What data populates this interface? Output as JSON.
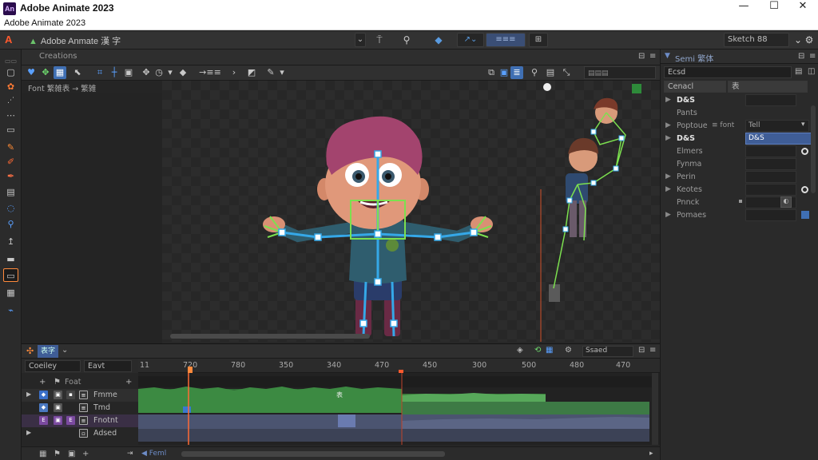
{
  "window": {
    "title": "Adobe Animate 2023",
    "menu": "Adobe Animate 2023",
    "logo": "An",
    "controls": [
      "—",
      "☐",
      "✕"
    ]
  },
  "appbar": {
    "doc_title": "Adobe Anmate 漢 字",
    "workspace": "Sketch 88",
    "mode_btn": "≡≡≡"
  },
  "stage_panel": {
    "tab": "Creations",
    "scene": "Font 繁雑表 → 繁雑",
    "zoom": "→≡≡"
  },
  "properties": {
    "header": "Semi 繁体",
    "search": "Ecsd",
    "tabs": [
      "Cenacl",
      "表"
    ],
    "rows": [
      {
        "label": "D&S",
        "bold": true,
        "value": ""
      },
      {
        "label": "Pants",
        "bold": false,
        "value": ""
      },
      {
        "label": "Poptoue",
        "bold": false,
        "value": "Tell",
        "note": "≡ font"
      },
      {
        "label": "D&S",
        "bold": true,
        "value": "D&S",
        "selected": true
      },
      {
        "label": "Elmers",
        "bold": false,
        "value": ""
      },
      {
        "label": "Fynma",
        "bold": false,
        "value": ""
      },
      {
        "label": "Perin",
        "bold": false,
        "value": ""
      },
      {
        "label": "Keotes",
        "bold": false,
        "value": ""
      },
      {
        "label": "Pnnck",
        "bold": false,
        "value": ""
      },
      {
        "label": "Pomaes",
        "bold": false,
        "value": ""
      }
    ]
  },
  "timeline": {
    "tab": "表字",
    "search_left": "Coeiley",
    "search_right": "Eavt",
    "layers_header": "Foat",
    "right_btn": "Ssaed",
    "ruler": [
      "11",
      "720",
      "780",
      "350",
      "340",
      "470",
      "450",
      "300",
      "500",
      "480",
      "470"
    ],
    "layers": [
      {
        "name": "Fmme",
        "color": "#3a6fc8"
      },
      {
        "name": "Tmd",
        "color": "#4a78c0"
      },
      {
        "name": "Fnotnt",
        "color": "#7b4aa0"
      },
      {
        "name": "Adsed",
        "color": "#777777"
      }
    ],
    "keyframe_label": "表",
    "footer": "Feml"
  },
  "colors": {
    "accent": "#ff8a3c",
    "selection": "#3f5d96",
    "bone": "#35a8e8",
    "joint": "#7ce04f",
    "track_green": "#3c7a3c",
    "track_blue": "#4b5470"
  }
}
